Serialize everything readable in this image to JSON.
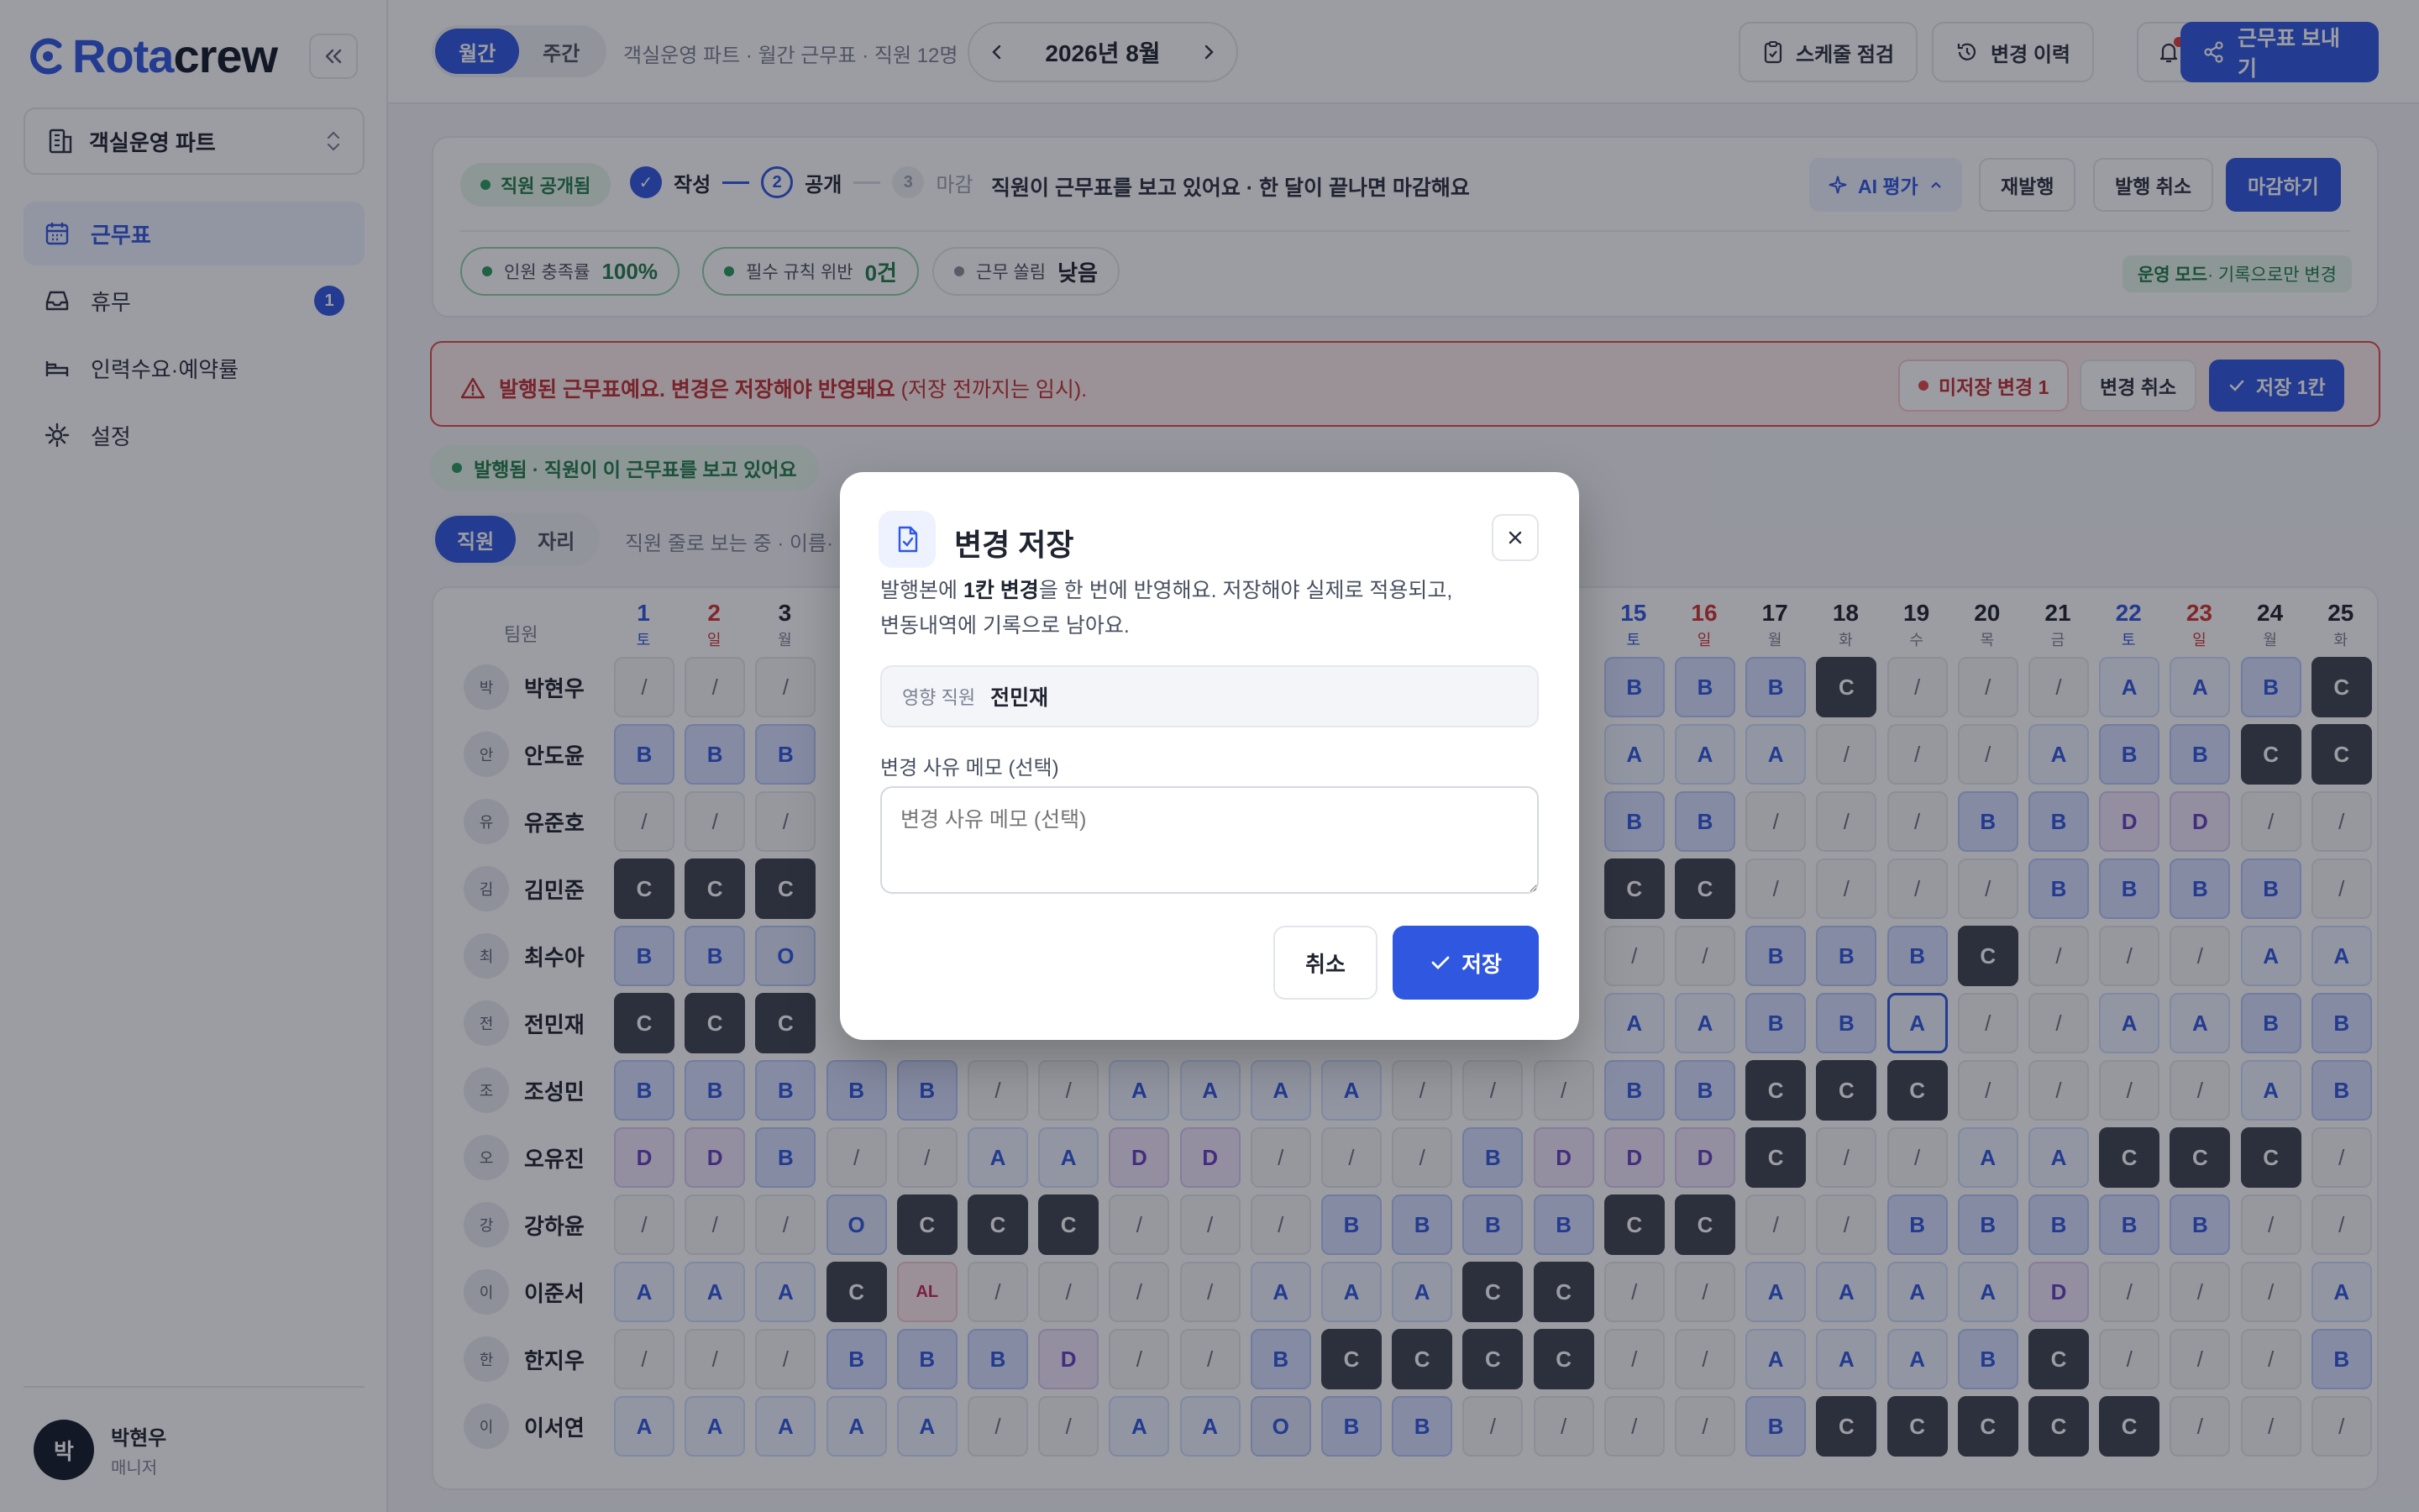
{
  "app": {
    "logo": "Rotacrew",
    "logo_mark": "C"
  },
  "sidebar": {
    "part_select": "객실운영 파트",
    "items": [
      {
        "label": "근무표",
        "icon": "calendar-icon",
        "active": true
      },
      {
        "label": "휴무",
        "icon": "inbox-icon",
        "badge": "1"
      },
      {
        "label": "인력수요·예약률",
        "icon": "bed-icon"
      },
      {
        "label": "설정",
        "icon": "gear-icon"
      }
    ],
    "user": {
      "initial": "박",
      "name": "박현우",
      "role": "매니저"
    }
  },
  "topbar": {
    "view_tabs": [
      "월간",
      "주간"
    ],
    "breadcrumb": "객실운영 파트 · 월간 근무표 · 직원 12명",
    "month": "2026년 8월",
    "schedule_check": "스케줄 점검",
    "change_history": "변경 이력",
    "send_schedule": "근무표 보내기"
  },
  "status_card": {
    "status": "직원 공개됨",
    "steps": [
      {
        "num": "✓",
        "label": "작성"
      },
      {
        "num": "2",
        "label": "공개"
      },
      {
        "num": "3",
        "label": "마감"
      }
    ],
    "description": "직원이 근무표를 보고 있어요 · 한 달이 끝나면 마감해요",
    "ai_eval": "AI 평가",
    "republish": "재발행",
    "cancel_publish": "발행 취소",
    "close_month": "마감하기",
    "metrics": [
      {
        "label": "인원 충족률",
        "value": "100%"
      },
      {
        "label": "필수 규칙 위반",
        "value": "0건"
      },
      {
        "label": "근무 쏠림",
        "value": "낮음"
      }
    ],
    "op_mode": "운영 모드",
    "op_mode_desc": " · 기록으로만 변경"
  },
  "alert": {
    "text": "발행된 근무표예요. 변경은 저장해야 반영돼요",
    "sub": " (저장 전까지는 임시).",
    "unsaved": "미저장 변경 1",
    "cancel_changes": "변경 취소",
    "save": "저장 1칸"
  },
  "published_pill": "발행됨 · 직원이 이 근무표를 보고 있어요",
  "view_toggle": {
    "tabs": [
      "직원",
      "자리"
    ],
    "hint": "직원 줄로 보는 중 · 이름·"
  },
  "grid": {
    "team_header": "팀원",
    "days": [
      {
        "d": "1",
        "w": "토",
        "t": "sat"
      },
      {
        "d": "2",
        "w": "일",
        "t": "sun"
      },
      {
        "d": "3",
        "w": "월",
        "t": ""
      },
      {
        "d": "15",
        "w": "토",
        "t": "sat"
      },
      {
        "d": "16",
        "w": "일",
        "t": "sun"
      },
      {
        "d": "17",
        "w": "월",
        "t": ""
      },
      {
        "d": "18",
        "w": "화",
        "t": ""
      },
      {
        "d": "19",
        "w": "수",
        "t": ""
      },
      {
        "d": "20",
        "w": "목",
        "t": ""
      },
      {
        "d": "21",
        "w": "금",
        "t": ""
      },
      {
        "d": "22",
        "w": "토",
        "t": "sat"
      },
      {
        "d": "23",
        "w": "일",
        "t": "sun"
      },
      {
        "d": "24",
        "w": "월",
        "t": ""
      },
      {
        "d": "25",
        "w": "화",
        "t": ""
      }
    ],
    "rows": [
      {
        "initial": "박",
        "name": "박현우",
        "cells": [
          "/",
          "/",
          "/",
          "",
          "",
          "",
          "",
          "",
          "",
          "",
          "",
          "",
          "",
          "",
          "",
          "B",
          "B",
          "B",
          "C",
          "/",
          "/",
          "/",
          "A",
          "A",
          "B",
          "C"
        ]
      },
      {
        "initial": "안",
        "name": "안도윤",
        "cells": [
          "B",
          "B",
          "B",
          "",
          "",
          "",
          "",
          "",
          "",
          "",
          "",
          "",
          "",
          "",
          "",
          "A",
          "A",
          "A",
          "/",
          "/",
          "/",
          "A",
          "B",
          "B",
          "C",
          "C"
        ]
      },
      {
        "initial": "유",
        "name": "유준호",
        "cells": [
          "/",
          "/",
          "/",
          "",
          "",
          "",
          "",
          "",
          "",
          "",
          "",
          "",
          "",
          "",
          "",
          "B",
          "B",
          "/",
          "/",
          "/",
          "B",
          "B",
          "D",
          "D",
          "/",
          "/"
        ]
      },
      {
        "initial": "김",
        "name": "김민준",
        "cells": [
          "C",
          "C",
          "C",
          "",
          "",
          "",
          "",
          "",
          "",
          "",
          "",
          "",
          "",
          "",
          "",
          "C",
          "C",
          "/",
          "/",
          "/",
          "/",
          "B",
          "B",
          "B",
          "B",
          "/"
        ]
      },
      {
        "initial": "최",
        "name": "최수아",
        "cells": [
          "B",
          "B",
          "O",
          "",
          "",
          "",
          "",
          "",
          "",
          "",
          "",
          "",
          "",
          "",
          "",
          "/",
          "/",
          "B",
          "B",
          "B",
          "C",
          "/",
          "/",
          "/",
          "A",
          "A"
        ]
      },
      {
        "initial": "전",
        "name": "전민재",
        "cells": [
          "C",
          "C",
          "C",
          "",
          "",
          "",
          "",
          "",
          "",
          "",
          "",
          "",
          "",
          "",
          "",
          "A",
          "A",
          "B",
          "B",
          "A*",
          "/",
          "/",
          "A",
          "A",
          "B",
          "B"
        ]
      },
      {
        "initial": "조",
        "name": "조성민",
        "cells": [
          "B",
          "B",
          "B",
          "B",
          "B",
          "/",
          "/",
          "A",
          "A",
          "A",
          "A",
          "/",
          "/",
          "/",
          "",
          "B",
          "B",
          "C",
          "C",
          "C",
          "/",
          "/",
          "/",
          "/",
          "A",
          "B"
        ]
      },
      {
        "initial": "오",
        "name": "오유진",
        "cells": [
          "D",
          "D",
          "B",
          "/",
          "/",
          "A",
          "A",
          "D",
          "D",
          "/",
          "/",
          "/",
          "B",
          "D",
          "",
          "D",
          "D",
          "C",
          "/",
          "/",
          "A",
          "A",
          "C",
          "C",
          "C",
          "/"
        ]
      },
      {
        "initial": "강",
        "name": "강하윤",
        "cells": [
          "/",
          "/",
          "/",
          "O",
          "C",
          "C",
          "C",
          "/",
          "/",
          "/",
          "B",
          "B",
          "B",
          "B",
          "",
          "C",
          "C",
          "/",
          "/",
          "B",
          "B",
          "B",
          "B",
          "B",
          "/",
          "/"
        ]
      },
      {
        "initial": "이",
        "name": "이준서",
        "cells": [
          "A",
          "A",
          "A",
          "C",
          "AL",
          "/",
          "/",
          "/",
          "/",
          "A",
          "A",
          "A",
          "C",
          "C",
          "",
          "/",
          "/",
          "A",
          "A",
          "A",
          "A",
          "D",
          "/",
          "/",
          "/",
          "A"
        ]
      },
      {
        "initial": "한",
        "name": "한지우",
        "cells": [
          "/",
          "/",
          "/",
          "B",
          "B",
          "B",
          "D",
          "/",
          "/",
          "B",
          "C",
          "C",
          "C",
          "C",
          "",
          "/",
          "/",
          "A",
          "A",
          "A",
          "B",
          "C",
          "/",
          "/",
          "/",
          "B"
        ]
      },
      {
        "initial": "이",
        "name": "이서연",
        "cells": [
          "A",
          "A",
          "A",
          "A",
          "A",
          "/",
          "/",
          "A",
          "A",
          "O",
          "B",
          "B",
          "/",
          "/",
          "",
          "/",
          "/",
          "B",
          "C",
          "C",
          "C",
          "C",
          "C",
          "/",
          "/",
          "/"
        ]
      }
    ]
  },
  "modal": {
    "title": "변경 저장",
    "desc_pre": "발행본에 ",
    "desc_bold": "1칸 변경",
    "desc_post": "을 한 번에 반영해요. 저장해야 실제로 적용되고,",
    "desc_line2": "변동내역에 기록으로 남아요.",
    "affected_label": "영향 직원",
    "affected_value": "전민재",
    "memo_label": "변경 사유 메모 (선택)",
    "memo_placeholder": "변경 사유 메모 (선택)",
    "cancel": "취소",
    "save": "저장"
  }
}
